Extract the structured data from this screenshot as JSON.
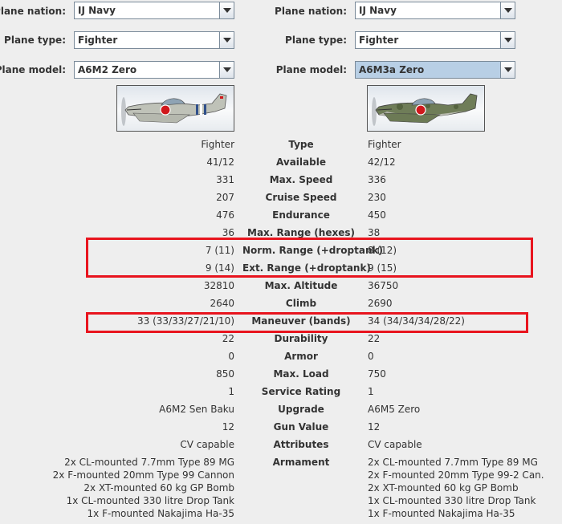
{
  "selectors": {
    "nation_label": "Plane nation:",
    "type_label": "Plane type:",
    "model_label": "Plane model:",
    "left": {
      "nation": "IJ Navy",
      "type": "Fighter",
      "model": "A6M2 Zero"
    },
    "right": {
      "nation": "IJ Navy",
      "type": "Fighter",
      "model": "A6M3a Zero"
    }
  },
  "stats": [
    {
      "label": "Type",
      "left": "Fighter",
      "right": "Fighter"
    },
    {
      "label": "Available",
      "left": "41/12",
      "right": "42/12"
    },
    {
      "label": "Max. Speed",
      "left": "331",
      "right": "336"
    },
    {
      "label": "Cruise Speed",
      "left": "207",
      "right": "230"
    },
    {
      "label": "Endurance",
      "left": "476",
      "right": "450"
    },
    {
      "label": "Max. Range (hexes)",
      "left": "36",
      "right": "38"
    },
    {
      "label": "Norm. Range (+droptank)",
      "left": "7 (11)",
      "right": "8 (12)"
    },
    {
      "label": "Ext. Range (+droptank)",
      "left": "9 (14)",
      "right": "9 (15)"
    },
    {
      "label": "Max. Altitude",
      "left": "32810",
      "right": "36750"
    },
    {
      "label": "Climb",
      "left": "2640",
      "right": "2690"
    },
    {
      "label": "Maneuver (bands)",
      "left": "33 (33/33/27/21/10)",
      "right": "34 (34/34/34/28/22)"
    },
    {
      "label": "Durability",
      "left": "22",
      "right": "22"
    },
    {
      "label": "Armor",
      "left": "0",
      "right": "0"
    },
    {
      "label": "Max. Load",
      "left": "850",
      "right": "750"
    },
    {
      "label": "Service Rating",
      "left": "1",
      "right": "1"
    },
    {
      "label": "Upgrade",
      "left": "A6M2 Sen Baku",
      "right": "A6M5 Zero"
    },
    {
      "label": "Gun Value",
      "left": "12",
      "right": "12"
    },
    {
      "label": "Attributes",
      "left": "CV capable",
      "right": "CV capable"
    }
  ],
  "armament": {
    "label": "Armament",
    "left": [
      "2x CL-mounted 7.7mm Type 89 MG",
      "2x F-mounted 20mm Type 99 Cannon",
      "2x XT-mounted 60 kg GP Bomb",
      "1x CL-mounted 330 litre Drop Tank",
      "1x F-mounted Nakajima Ha-35"
    ],
    "right": [
      "2x CL-mounted 7.7mm Type 89 MG",
      "2x F-mounted 20mm Type 99-2 Can.",
      "2x XT-mounted 60 kg GP Bomb",
      "1x CL-mounted 330 litre Drop Tank",
      "1x F-mounted Nakajima Ha-35"
    ]
  },
  "colors": {
    "highlight": "#e8141e",
    "hinomaru": "#d0181c",
    "selected_combo": "#b8cfe5"
  }
}
